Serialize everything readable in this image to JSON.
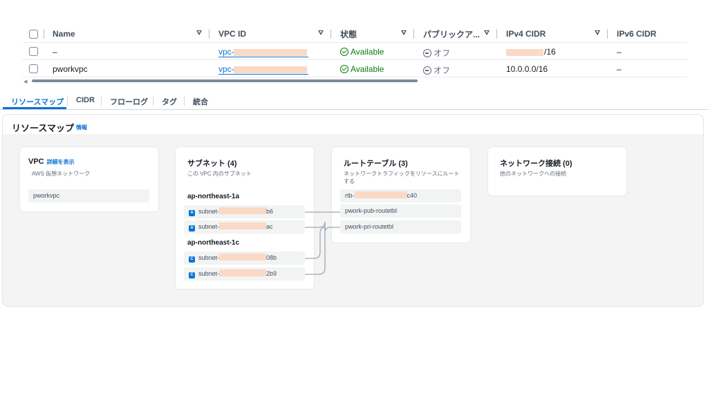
{
  "table": {
    "columns": [
      "Name",
      "VPC ID",
      "状態",
      "パブリックア...",
      "IPv4 CIDR",
      "IPv6 CIDR"
    ],
    "rows": [
      {
        "name": "–",
        "vpc_id_prefix": "vpc-",
        "state": "Available",
        "public_access": "オフ",
        "ipv4_cidr": "/16",
        "ipv6_cidr": "–"
      },
      {
        "name": "pworkvpc",
        "vpc_id_prefix": "vpc-",
        "state": "Available",
        "public_access": "オフ",
        "ipv4_cidr": "10.0.0.0/16",
        "ipv6_cidr": "–"
      }
    ]
  },
  "tabs": [
    "リソースマップ",
    "CIDR",
    "フローログ",
    "タグ",
    "統合"
  ],
  "resource_map": {
    "title": "リソースマップ",
    "info": "情報",
    "vpc": {
      "title": "VPC",
      "link": "詳細を表示",
      "subtitle": "AWS 仮想ネットワーク",
      "item": "pworkvpc"
    },
    "subnets": {
      "title": "サブネット (4)",
      "subtitle": "この VPC 内のサブネット",
      "zones": [
        {
          "name": "ap-northeast-1a",
          "badge": "A",
          "items": [
            {
              "prefix": "subnet-",
              "suffix": "b6"
            },
            {
              "prefix": "subnet-",
              "suffix": "ac"
            }
          ]
        },
        {
          "name": "ap-northeast-1c",
          "badge": "C",
          "items": [
            {
              "prefix": "subnet-",
              "suffix": "08b"
            },
            {
              "prefix": "subnet-",
              "suffix": "2b9"
            }
          ]
        }
      ]
    },
    "route_tables": {
      "title": "ルートテーブル (3)",
      "subtitle_line1": "ネットワークトラフィックをリソースにルート",
      "subtitle_line2": "する",
      "items": [
        {
          "prefix": "rtb-",
          "suffix": "c40"
        },
        {
          "label": "pwork-pub-routetbl"
        },
        {
          "label": "pwork-pri-routetbl"
        }
      ]
    },
    "network_connections": {
      "title": "ネットワーク接続 (0)",
      "subtitle": "他のネットワークへの接続"
    }
  },
  "colors": {
    "accent": "#0972d3",
    "success": "#037f0c",
    "redaction": "#fad9c6"
  }
}
